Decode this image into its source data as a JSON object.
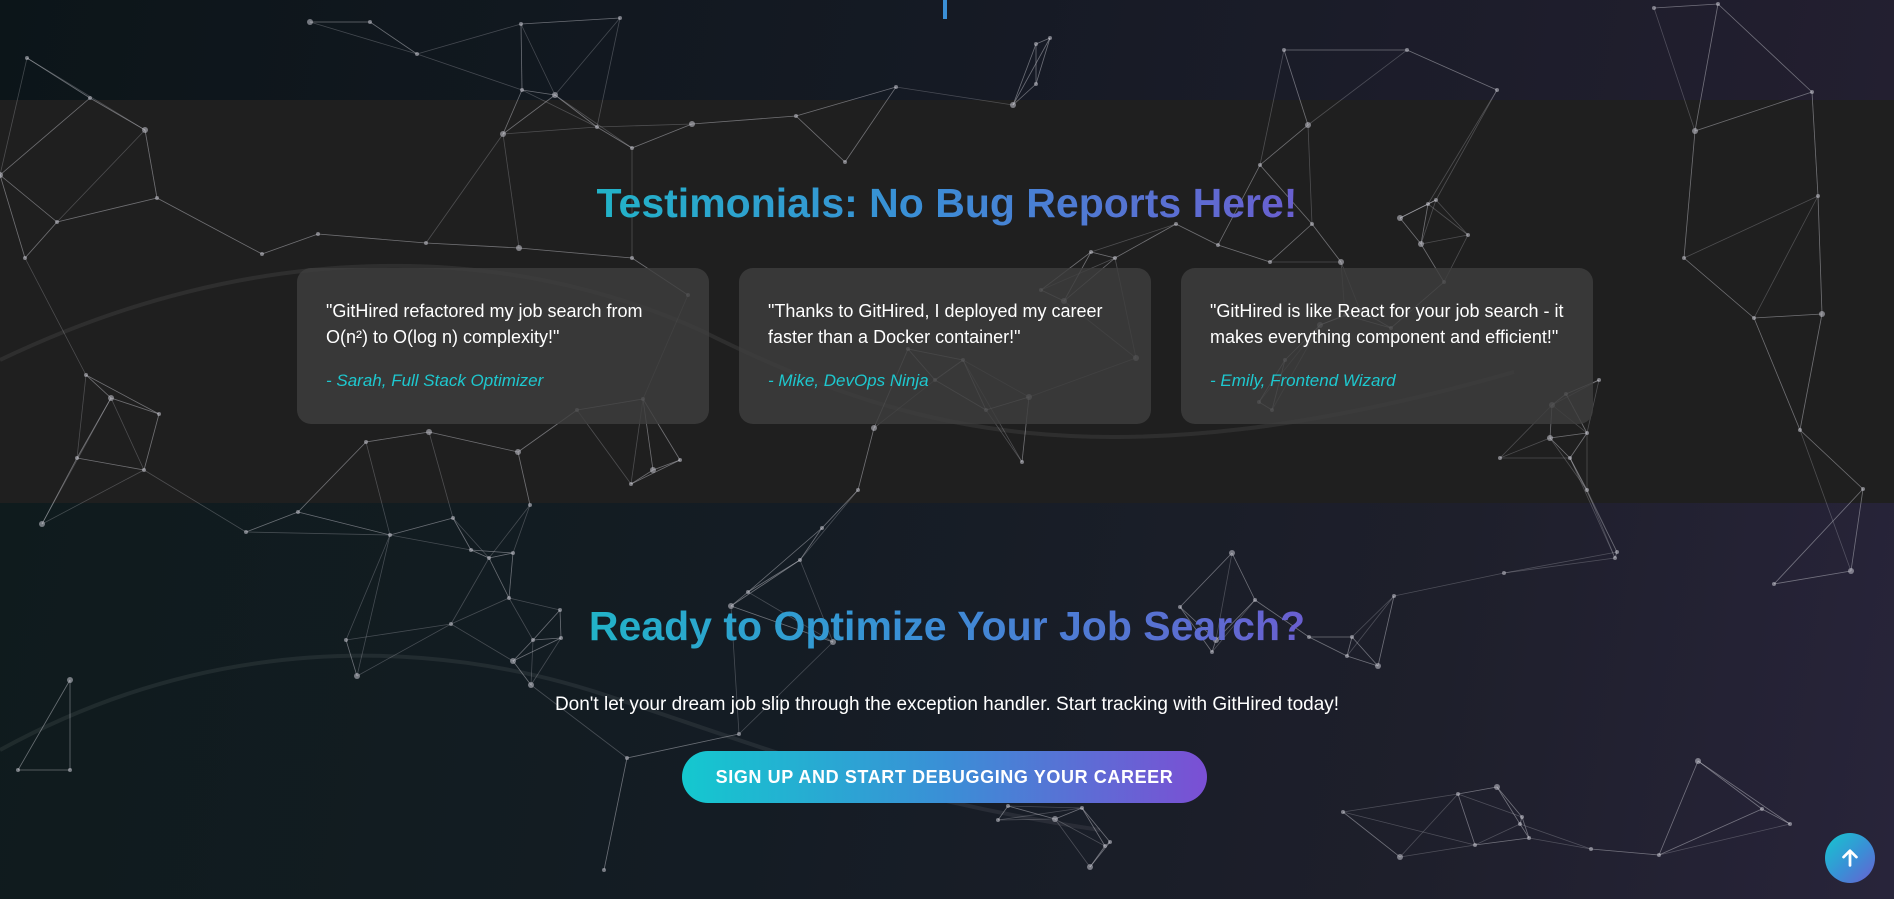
{
  "testimonials": {
    "title": "Testimonials: No Bug Reports Here!",
    "items": [
      {
        "quote": "\"GitHired refactored my job search from O(n²) to O(log n) complexity!\"",
        "author": "- Sarah, Full Stack Optimizer"
      },
      {
        "quote": "\"Thanks to GitHired, I deployed my career faster than a Docker container!\"",
        "author": "- Mike, DevOps Ninja"
      },
      {
        "quote": "\"GitHired is like React for your job search - it makes everything component and efficient!\"",
        "author": "- Emily, Frontend Wizard"
      }
    ]
  },
  "cta": {
    "title": "Ready to Optimize Your Job Search?",
    "text": "Don't let your dream job slip through the exception handler. Start tracking with GitHired today!",
    "button_label": "SIGN UP AND START DEBUGGING YOUR CAREER"
  },
  "back_to_top": {
    "icon": "arrow-up-icon"
  },
  "colors": {
    "accent_cyan": "#14c8cf",
    "accent_blue": "#3a8fd6",
    "accent_purple": "#7b4fd4",
    "author_text": "#1ec8cf",
    "testimonials_bg": "#1f1f1f",
    "card_bg": "#3e3e3e"
  }
}
